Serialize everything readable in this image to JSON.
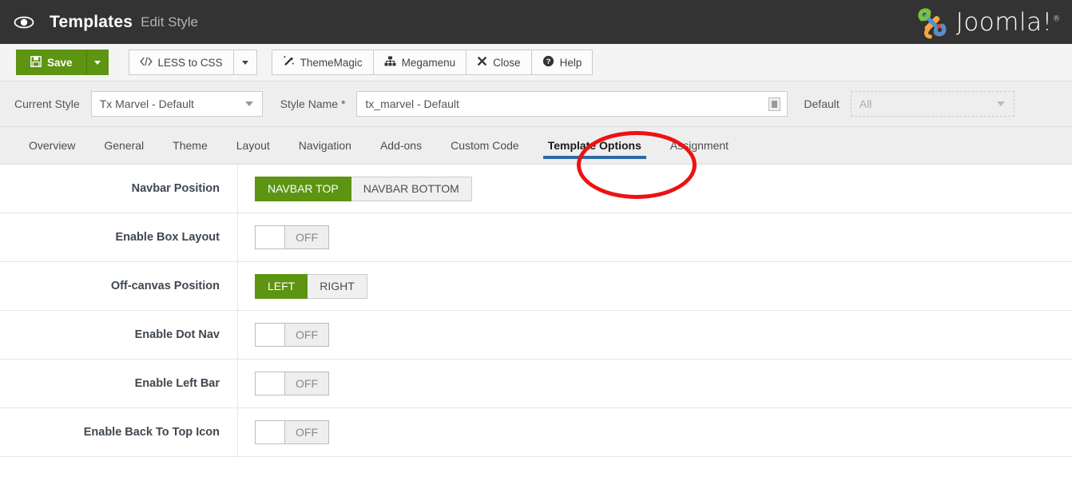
{
  "header": {
    "icon": "eye-icon",
    "title": "Templates",
    "subtitle": "Edit Style",
    "brand": "Joomla!",
    "brand_reg": "®"
  },
  "toolbar": {
    "save_label": "Save",
    "save_icon": "floppy-disk-icon",
    "less_to_css_label": "LESS to CSS",
    "less_to_css_icon": "code-icon",
    "thememagic_label": "ThemeMagic",
    "thememagic_icon": "magic-wand-icon",
    "megamenu_label": "Megamenu",
    "megamenu_icon": "sitemap-icon",
    "close_label": "Close",
    "close_icon": "x-icon",
    "help_label": "Help",
    "help_icon": "question-circle-icon"
  },
  "stylebar": {
    "current_style_label": "Current Style",
    "current_style_value": "Tx Marvel - Default",
    "style_name_label": "Style Name *",
    "style_name_value": "tx_marvel - Default",
    "default_label": "Default",
    "default_value": "All"
  },
  "tabs": [
    {
      "label": "Overview",
      "active": false
    },
    {
      "label": "General",
      "active": false
    },
    {
      "label": "Theme",
      "active": false
    },
    {
      "label": "Layout",
      "active": false
    },
    {
      "label": "Navigation",
      "active": false
    },
    {
      "label": "Add-ons",
      "active": false
    },
    {
      "label": "Custom Code",
      "active": false
    },
    {
      "label": "Template Options",
      "active": true
    },
    {
      "label": "Assignment",
      "active": false
    }
  ],
  "options": [
    {
      "label": "Navbar Position",
      "type": "segmented",
      "choices": [
        "NAVBAR TOP",
        "NAVBAR BOTTOM"
      ],
      "selected": "NAVBAR TOP"
    },
    {
      "label": "Enable Box Layout",
      "type": "toggle",
      "state": "OFF"
    },
    {
      "label": "Off-canvas Position",
      "type": "segmented",
      "choices": [
        "LEFT",
        "RIGHT"
      ],
      "selected": "LEFT"
    },
    {
      "label": "Enable Dot Nav",
      "type": "toggle",
      "state": "OFF"
    },
    {
      "label": "Enable Left Bar",
      "type": "toggle",
      "state": "OFF"
    },
    {
      "label": "Enable Back To Top Icon",
      "type": "toggle",
      "state": "OFF"
    }
  ],
  "colors": {
    "header_bg": "#333333",
    "accent_green": "#5d9412",
    "tab_underline": "#2a6ba8",
    "annotation_red": "#ee1111"
  }
}
